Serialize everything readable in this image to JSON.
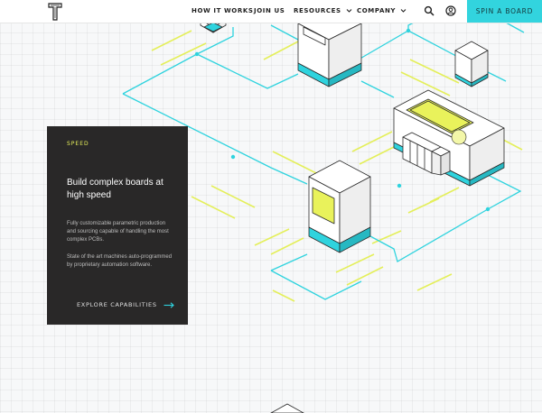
{
  "nav": {
    "items": [
      {
        "label": "HOW IT WORKS"
      },
      {
        "label": "JOIN US"
      },
      {
        "label": "RESOURCES"
      },
      {
        "label": "COMPANY"
      }
    ],
    "cta_label": "SPIN A BOARD",
    "icons": [
      "search-icon",
      "account-icon"
    ]
  },
  "card": {
    "eyebrow": "SPEED",
    "title": "Build complex boards at high speed",
    "body": [
      "Fully customizable parametric production and sourcing capable of handling the most complex PCBs.",
      "State of the art machines auto-programmed by proprietary automation software."
    ],
    "link_label": "EXPLORE CAPABILITIES"
  },
  "colors": {
    "accent": "#32d4de",
    "highlight": "#e9f25b",
    "card_bg": "#292828"
  }
}
